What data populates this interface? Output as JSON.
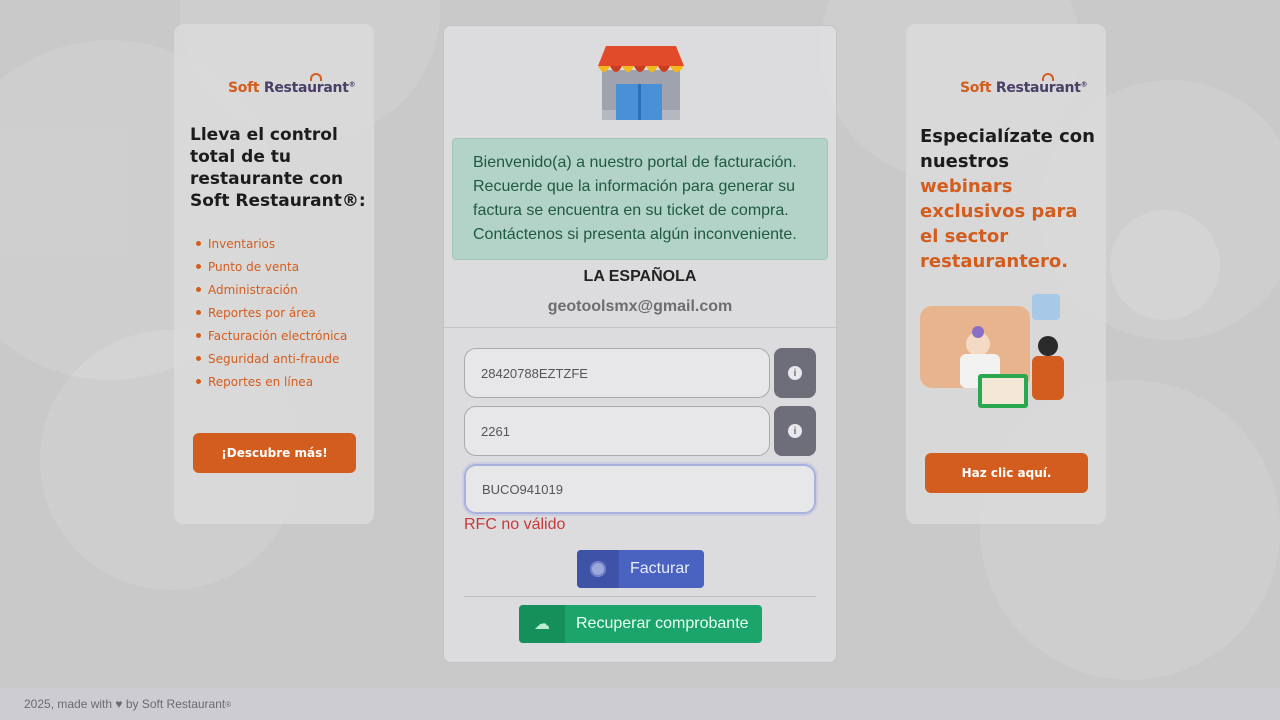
{
  "left_promo": {
    "logo_soft": "Soft",
    "logo_rest": "Restaurant",
    "heading": "Lleva el control total de tu restaurante con Soft Restaurant®:",
    "features": [
      "Inventarios",
      "Punto de venta",
      "Administración",
      "Reportes por área",
      "Facturación electrónica",
      "Seguridad anti-fraude",
      "Reportes en línea"
    ],
    "button_label": "¡Descubre más!"
  },
  "right_promo": {
    "logo_soft": "Soft",
    "logo_rest": "Restaurant",
    "heading_dark": "Especialízate con nuestros",
    "heading_orange": "webinars exclusivos para el sector restaurantero.",
    "button_label": "Haz clic aquí."
  },
  "card": {
    "alert": "Bienvenido(a) a nuestro portal de facturación. Recuerde que la información para generar su factura se encuentra en su ticket de compra. Contáctenos si presenta algún inconveniente.",
    "company": "LA ESPAÑOLA",
    "email": "geotoolsmx@gmail.com",
    "field1_value": "28420788EZTZFE",
    "field2_value": "2261",
    "field3_value": "BUCO941019",
    "error": "RFC no válido",
    "facturar_label": "Facturar",
    "recuperar_label": "Recuperar comprobante"
  },
  "footer": {
    "text": "2025, made with ♥ by Soft Restaurant",
    "reg": "®"
  },
  "colors": {
    "brand_orange": "#d35d1e",
    "primary_blue": "#4a62c0",
    "success_green": "#1ba56a",
    "error_red": "#c53a3a"
  }
}
